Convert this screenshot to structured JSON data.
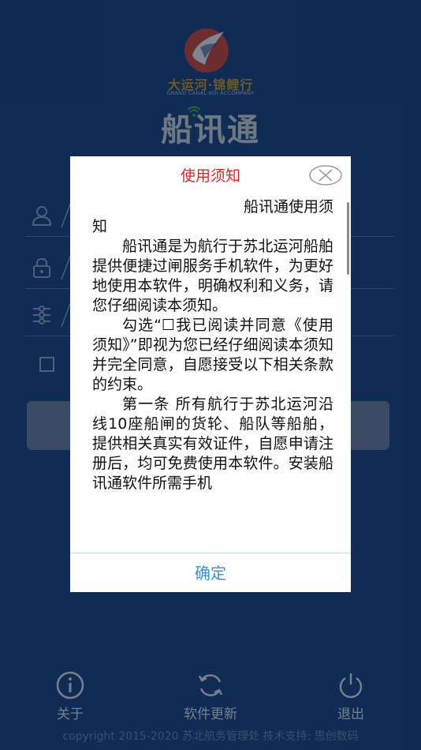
{
  "brand": {
    "logo_cn": "大运河·锦鲤行",
    "logo_en": "GRAND CANAL·KOI ACCOMPANY",
    "app_name": "船讯通"
  },
  "dialog": {
    "title": "使用须知",
    "doc_title_line1": "船讯通使用须",
    "doc_title_line2": "知",
    "paragraphs": [
      "船讯通是为航行于苏北运河船舶提供便捷过闸服务手机软件，为更好地使用本软件，明确权利和义务，请您仔细阅读本须知。",
      "勾选“☐我已阅读并同意《使用须知》”即视为您已经仔细阅读本须知并完全同意，自愿接受以下相关条款的约束。",
      "第一条  所有航行于苏北运河沿线10座船闸的货轮、船队等船舶，提供相关真实有效证件，自愿申请注册后，均可免费使用本软件。安装船讯通软件所需手机"
    ],
    "confirm_label": "确定"
  },
  "nav": {
    "about_label": "关于",
    "update_label": "软件更新",
    "exit_label": "退出"
  },
  "copyright": "copyright 2015-2020 苏北航务管理处 技术支持: 思创数码",
  "colors": {
    "background": "#1e4580",
    "dialog_title": "#e52222",
    "confirm": "#3d8fd0"
  }
}
